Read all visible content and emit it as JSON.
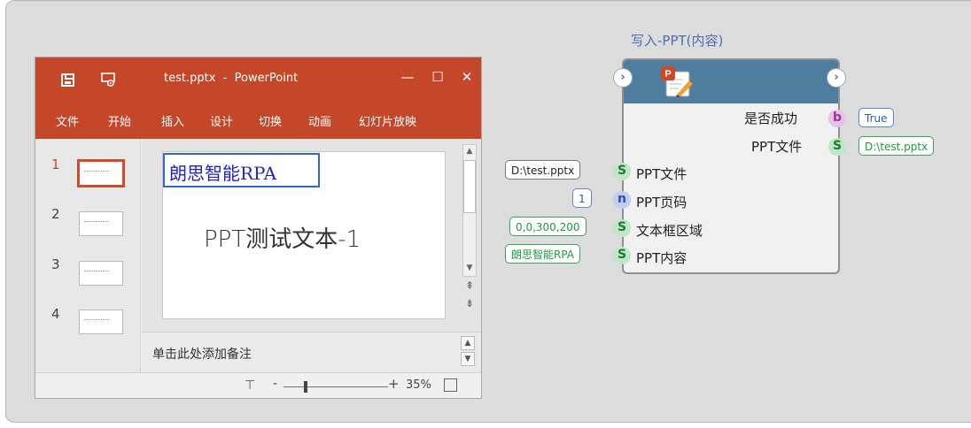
{
  "ppt_window": {
    "doc_title": "test.pptx  -  PowerPoint",
    "window_buttons": {
      "minimize": "—",
      "maximize": "☐",
      "close": "✕"
    },
    "ribbon_tabs": [
      "文件",
      "开始",
      "插入",
      "设计",
      "切换",
      "动画",
      "幻灯片放映"
    ],
    "slide_numbers": [
      "1",
      "2",
      "3",
      "4"
    ],
    "selected_slide": 1,
    "slide": {
      "title_box_text": "朗思智能RPA",
      "body_text": "PPT测试文本-1"
    },
    "notes_placeholder": "单击此处添加备注",
    "status": {
      "zoom_minus": "-",
      "zoom_plus": "+",
      "zoom_value": "35%"
    },
    "accent_color": "#c4472a"
  },
  "rpa_node": {
    "title": "写入-PPT(内容)",
    "header_color": "#4f7da0",
    "outputs": [
      {
        "label": "是否成功",
        "type": "b",
        "value": "True"
      },
      {
        "label": "PPT文件",
        "type": "S",
        "value": "D:\\test.pptx"
      }
    ],
    "inputs": [
      {
        "label": "PPT文件",
        "type": "S",
        "value": "D:\\test.pptx"
      },
      {
        "label": "PPT页码",
        "type": "n",
        "value": "1"
      },
      {
        "label": "文本框区域",
        "type": "S",
        "value": "0,0,300,200"
      },
      {
        "label": "PPT内容",
        "type": "S",
        "value": "朗思智能RPA"
      }
    ]
  }
}
